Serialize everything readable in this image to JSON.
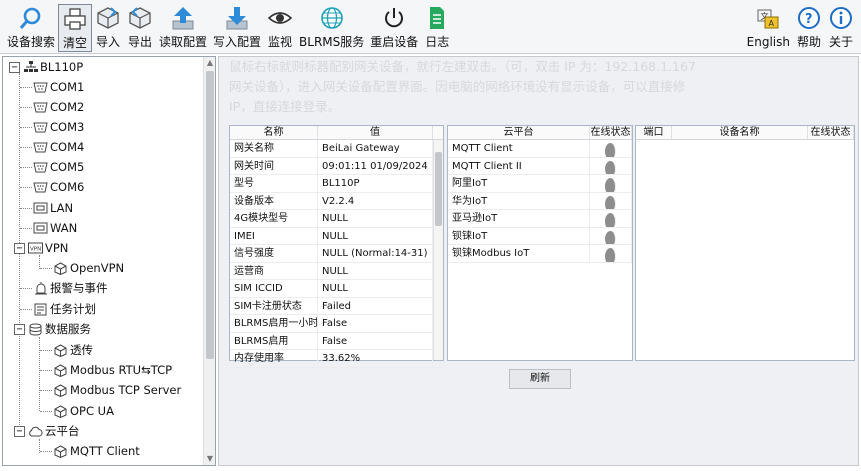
{
  "toolbar": {
    "left": [
      {
        "label": "设备搜索",
        "icon": "search-icon"
      },
      {
        "label": "清空",
        "icon": "printer-icon"
      },
      {
        "label": "导入",
        "icon": "import-icon"
      },
      {
        "label": "导出",
        "icon": "export-icon"
      },
      {
        "label": "读取配置",
        "icon": "upload-icon"
      },
      {
        "label": "写入配置",
        "icon": "download-icon"
      },
      {
        "label": "监视",
        "icon": "eye-icon"
      },
      {
        "label": "BLRMS服务",
        "icon": "globe-icon"
      },
      {
        "label": "重启设备",
        "icon": "power-icon"
      },
      {
        "label": "日志",
        "icon": "log-icon"
      }
    ],
    "right": [
      {
        "label": "English",
        "icon": "language-icon"
      },
      {
        "label": "帮助",
        "icon": "help-icon"
      },
      {
        "label": "关于",
        "icon": "info-icon"
      }
    ]
  },
  "tree": {
    "root": "BL110P",
    "com_ports": [
      "COM1",
      "COM2",
      "COM3",
      "COM4",
      "COM5",
      "COM6"
    ],
    "lan": "LAN",
    "wan": "WAN",
    "vpn": "VPN",
    "openvpn": "OpenVPN",
    "alarm": "报警与事件",
    "task": "任务计划",
    "data_service": "数据服务",
    "transparent": "透传",
    "modbus_rtu_tcp": "Modbus RTU⇆TCP",
    "modbus_tcp_server": "Modbus TCP Server",
    "opc_ua": "OPC UA",
    "cloud": "云平台",
    "mqtt_client": "MQTT Client"
  },
  "watermark": {
    "line1": "鼠标右标就则标器配别网关设备，就行左建双击。（可，双击 IP 为：192.168.1.167",
    "line2": "网关设备），进入网关设备配置界面。因电脑的网络环境没有显示设备，可以直接修",
    "line3": "IP，直接连接登录。"
  },
  "info_table": {
    "headers": [
      "名称",
      "值"
    ],
    "rows": [
      [
        "网关名称",
        "BeiLai Gateway"
      ],
      [
        "网关时间",
        "09:01:11 01/09/2024"
      ],
      [
        "型号",
        "BL110P"
      ],
      [
        "设备版本",
        "V2.2.4"
      ],
      [
        "4G模块型号",
        "NULL"
      ],
      [
        "IMEI",
        "NULL"
      ],
      [
        "信号强度",
        "NULL (Normal:14-31)"
      ],
      [
        "运营商",
        "NULL"
      ],
      [
        "SIM ICCID",
        "NULL"
      ],
      [
        "SIM卡注册状态",
        "Failed"
      ],
      [
        "BLRMS启用一小时",
        "False"
      ],
      [
        "BLRMS启用",
        "False"
      ],
      [
        "内存使用率",
        "33.62%"
      ]
    ]
  },
  "cloud_table": {
    "headers": [
      "云平台",
      "在线状态"
    ],
    "rows": [
      "MQTT Client",
      "MQTT Client II",
      "阿里IoT",
      "华为IoT",
      "亚马逊IoT",
      "钡铼IoT",
      "钡铼Modbus IoT"
    ]
  },
  "port_table": {
    "headers": [
      "端口",
      "设备名称",
      "在线状态"
    ]
  },
  "refresh_label": "刷新"
}
